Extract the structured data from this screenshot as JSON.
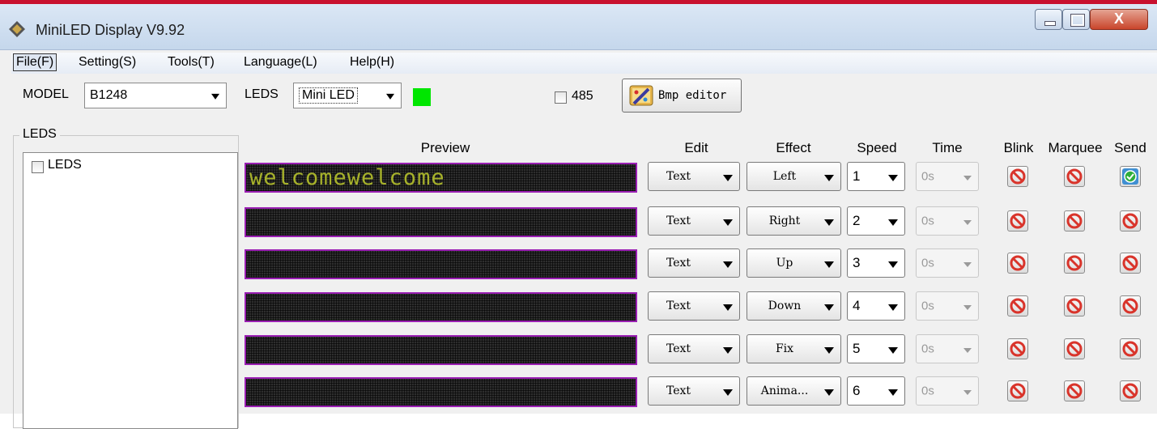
{
  "window": {
    "title": "MiniLED Display V9.92",
    "close_symbol": "X"
  },
  "menu": [
    "File(F)",
    "Setting(S)",
    "Tools(T)",
    "Language(L)",
    "Help(H)"
  ],
  "toolbar": {
    "model_label": "MODEL",
    "model_value": "B1248",
    "leds_label": "LEDS",
    "leds_value": "Mini LED",
    "status_color": "#00e600",
    "rs485_label": "485",
    "rs485_checked": false,
    "bmp_editor_label": "Bmp editor"
  },
  "leds_panel": {
    "title": "LEDS",
    "tree_items": [
      {
        "label": "LEDS",
        "checked": false
      }
    ]
  },
  "columns": {
    "preview": "Preview",
    "edit": "Edit",
    "effect": "Effect",
    "speed": "Speed",
    "time": "Time",
    "blink": "Blink",
    "marquee": "Marquee",
    "send": "Send"
  },
  "rows": [
    {
      "preview_text": "welcomewelcome",
      "edit": "Text",
      "effect": "Left",
      "speed": "1",
      "time": "0s",
      "blink": "off",
      "marquee": "off",
      "send": "on"
    },
    {
      "preview_text": "",
      "edit": "Text",
      "effect": "Right",
      "speed": "2",
      "time": "0s",
      "blink": "off",
      "marquee": "off",
      "send": "off"
    },
    {
      "preview_text": "",
      "edit": "Text",
      "effect": "Up",
      "speed": "3",
      "time": "0s",
      "blink": "off",
      "marquee": "off",
      "send": "off"
    },
    {
      "preview_text": "",
      "edit": "Text",
      "effect": "Down",
      "speed": "4",
      "time": "0s",
      "blink": "off",
      "marquee": "off",
      "send": "off"
    },
    {
      "preview_text": "",
      "edit": "Text",
      "effect": "Fix",
      "speed": "5",
      "time": "0s",
      "blink": "off",
      "marquee": "off",
      "send": "off"
    },
    {
      "preview_text": "",
      "edit": "Text",
      "effect": "Anima...",
      "speed": "6",
      "time": "0s",
      "blink": "off",
      "marquee": "off",
      "send": "off"
    }
  ],
  "icons": {
    "app": "diamond-app-icon",
    "bmp": "paint-palette-icon",
    "off": "no-sign-icon",
    "on": "check-circle-icon"
  },
  "colors": {
    "preview_border": "#9a1fb3",
    "preview_text": "#a7b22a",
    "off_icon": "#d9342b",
    "on_icon": "#2fae3a"
  }
}
